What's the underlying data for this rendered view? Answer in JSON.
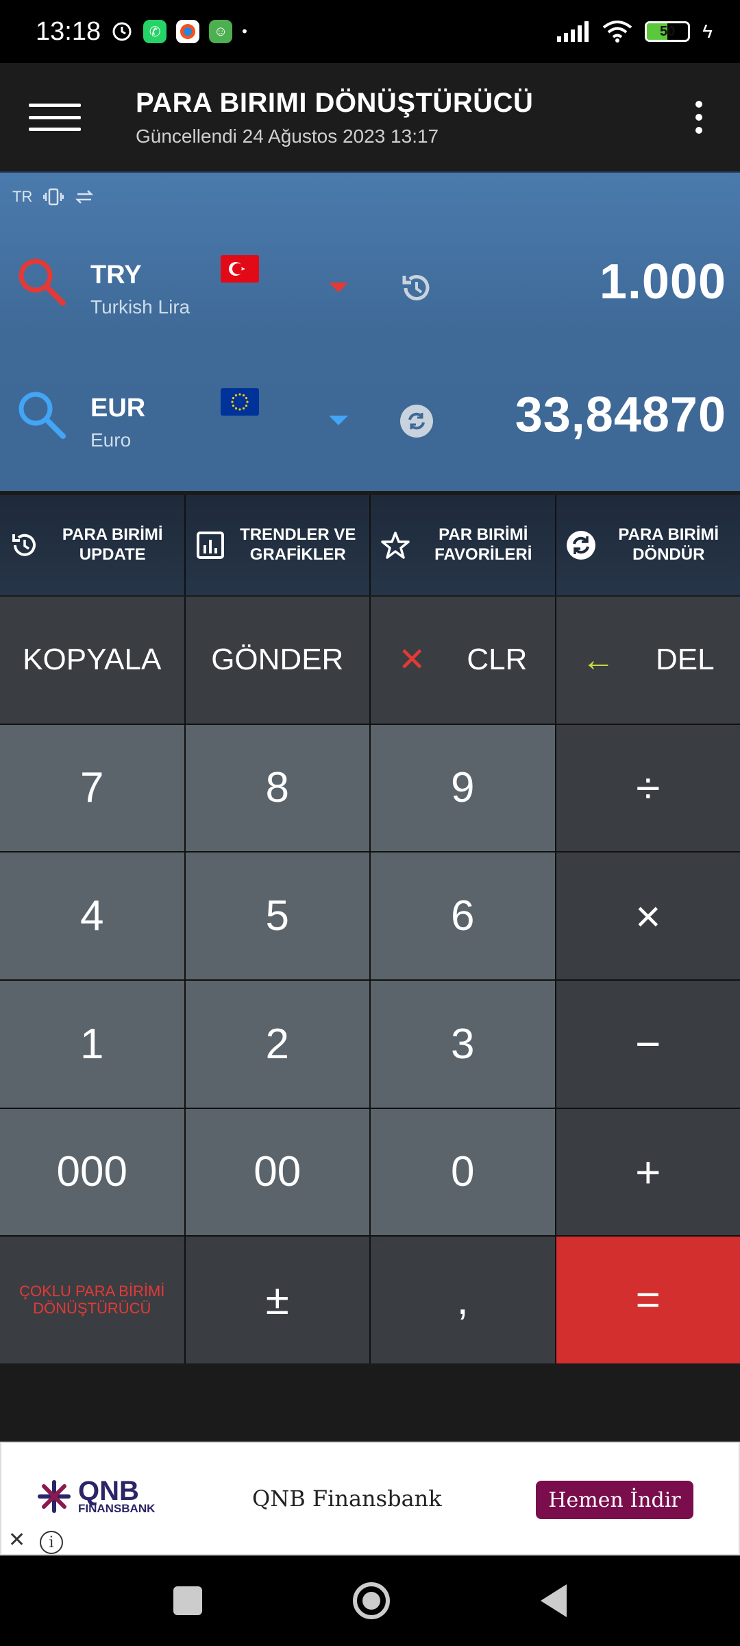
{
  "status_bar": {
    "time": "13:18",
    "battery": "50",
    "icons": [
      "alarm-icon",
      "whatsapp-icon",
      "browser-icon",
      "android-icon",
      "signal-icon",
      "wifi-icon",
      "battery-icon",
      "charging-icon"
    ]
  },
  "app_bar": {
    "title": "PARA BIRIMI DÖNÜŞTÜRÜCÜ",
    "subtitle": "Güncellendi 24 Ağustos 2023 13:17"
  },
  "converter": {
    "lang": "TR",
    "rows": [
      {
        "code": "TRY",
        "name": "Turkish Lira",
        "amount": "1.000",
        "flag": "tr-flag",
        "accent": "#e53935"
      },
      {
        "code": "EUR",
        "name": "Euro",
        "amount": "33,84870",
        "flag": "eu-flag",
        "accent": "#42a5f5"
      }
    ]
  },
  "tools": [
    {
      "label": "PARA BIRİMİ UPDATE",
      "icon": "update-icon"
    },
    {
      "label": "TRENDLER VE GRAFİKLER",
      "icon": "chart-icon"
    },
    {
      "label": "PAR BIRİMİ FAVORİLERİ",
      "icon": "star-icon"
    },
    {
      "label": "PARA BIRİMİ DÖNDÜR",
      "icon": "swap-icon"
    }
  ],
  "keypad": {
    "copy": "KOPYALA",
    "send": "GÖNDER",
    "clr": "CLR",
    "del": "DEL",
    "k7": "7",
    "k8": "8",
    "k9": "9",
    "div": "÷",
    "k4": "4",
    "k5": "5",
    "k6": "6",
    "mul": "×",
    "k1": "1",
    "k2": "2",
    "k3": "3",
    "minus": "−",
    "k000": "000",
    "k00": "00",
    "k0": "0",
    "plus": "+",
    "multi": "ÇOKLU PARA BİRİMİ DÖNÜŞTÜRÜCÜ",
    "sign": "±",
    "comma": ",",
    "equals": "="
  },
  "ad": {
    "logo_line1": "QNB",
    "logo_line2": "FINANSBANK",
    "name": "QNB Finansbank",
    "cta": "Hemen İndir"
  },
  "colors": {
    "header_bg": "#1c1c1c",
    "converter_bg": "#4a7aac",
    "num_key": "#5b646b",
    "op_key": "#3a3e43",
    "equals_key": "#d32f2f",
    "ad_cta": "#7a0d4b"
  }
}
